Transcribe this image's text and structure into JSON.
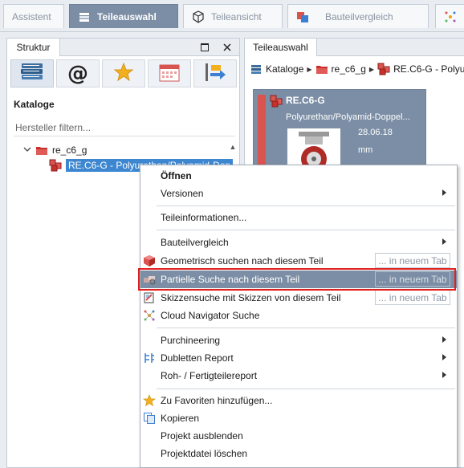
{
  "tabs": [
    {
      "label": "Assistent",
      "icon": "none"
    },
    {
      "label": "Teileauswahl",
      "icon": "catalog-stack-icon",
      "active": true
    },
    {
      "label": "Teileansicht",
      "icon": "cube-outline-icon"
    },
    {
      "label": "Bauteilvergleich",
      "icon": "parts-compare-icon"
    }
  ],
  "left_panel": {
    "tab_label": "Struktur",
    "section_title": "Kataloge",
    "filter_placeholder": "Hersteller filtern...",
    "tree": [
      {
        "label": "re_c6_g",
        "icon": "folder-red-icon",
        "expanded": true
      },
      {
        "label": "RE.C6-G - Polyurethan/Polyamid-Dop",
        "icon": "red-cubes-icon",
        "selected": true
      }
    ]
  },
  "right_panel": {
    "tab_label": "Teileauswahl",
    "breadcrumb": [
      "Kataloge",
      "re_c6_g",
      "RE.C6-G - Polyur"
    ],
    "tile": {
      "title": "RE.C6-G",
      "subtitle": "Polyurethan/Polyamid-Doppel...",
      "date": "28.06.18",
      "unit": "mm"
    }
  },
  "context_menu": {
    "new_tab_label": "... in neuem Tab",
    "items": {
      "open": "Öffnen",
      "versions": "Versionen",
      "part_info": "Teileinformationen...",
      "compare": "Bauteilvergleich",
      "geo_search": "Geometrisch suchen nach diesem Teil",
      "partial_search": "Partielle Suche nach diesem Teil",
      "sketch_search": "Skizzensuche mit Skizzen von diesem Teil",
      "cloud_nav": "Cloud Navigator Suche",
      "purchineering": "Purchineering",
      "duplicates": "Dubletten Report",
      "raw_parts": "Roh- / Fertigteilereport",
      "favorites": "Zu Favoriten hinzufügen...",
      "copy": "Kopieren",
      "hide_project": "Projekt ausblenden",
      "delete_project": "Projektdatei löschen"
    }
  },
  "colors": {
    "accent": "#7c8ea5",
    "highlight_box": "#e02020",
    "selection": "#3d87d1"
  }
}
